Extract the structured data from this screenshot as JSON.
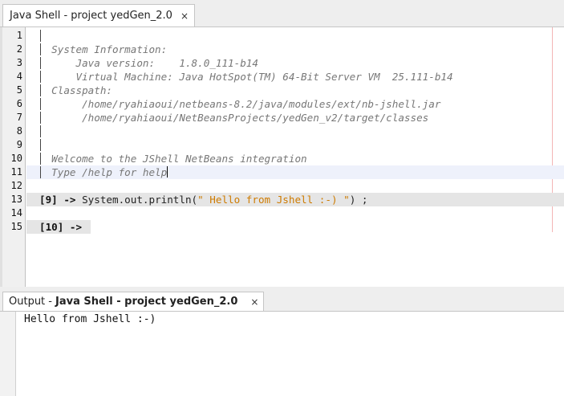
{
  "editor_tab": {
    "title": "Java Shell - project yedGen_2.0",
    "close": "×"
  },
  "editor": {
    "lines": [
      {
        "n": "1",
        "bar": true,
        "parts": []
      },
      {
        "n": "2",
        "bar": true,
        "parts": [
          {
            "t": "  System Information:",
            "c": "info"
          }
        ]
      },
      {
        "n": "3",
        "bar": true,
        "parts": [
          {
            "t": "      Java version:    1.8.0_111-b14",
            "c": "info"
          }
        ]
      },
      {
        "n": "4",
        "bar": true,
        "parts": [
          {
            "t": "      Virtual Machine: Java HotSpot(TM) 64-Bit Server VM  25.111-b14",
            "c": "info"
          }
        ]
      },
      {
        "n": "5",
        "bar": true,
        "parts": [
          {
            "t": "  Classpath:",
            "c": "info"
          }
        ]
      },
      {
        "n": "6",
        "bar": true,
        "parts": [
          {
            "t": "       /home/ryahiaoui/netbeans-8.2/java/modules/ext/nb-jshell.jar",
            "c": "info"
          }
        ]
      },
      {
        "n": "7",
        "bar": true,
        "parts": [
          {
            "t": "       /home/ryahiaoui/NetBeansProjects/yedGen_v2/target/classes",
            "c": "info"
          }
        ]
      },
      {
        "n": "8",
        "bar": true,
        "parts": []
      },
      {
        "n": "9",
        "bar": true,
        "parts": []
      },
      {
        "n": "10",
        "bar": true,
        "parts": [
          {
            "t": "  Welcome to the JShell NetBeans integration",
            "c": "info"
          }
        ]
      },
      {
        "n": "11",
        "bar": true,
        "current": true,
        "caret": true,
        "parts": [
          {
            "t": "  Type /help for help",
            "c": "info"
          }
        ]
      },
      {
        "n": "12",
        "bar": false,
        "parts": []
      },
      {
        "n": "13",
        "bar": false,
        "cmd": true,
        "parts": [
          {
            "t": "[9] -> ",
            "c": "prompt"
          },
          {
            "t": "System.out.println(",
            "c": ""
          },
          {
            "t": "\" Hello from Jshell :-) \"",
            "c": "str"
          },
          {
            "t": ") ;",
            "c": ""
          }
        ]
      },
      {
        "n": "14",
        "bar": false,
        "parts": []
      },
      {
        "n": "15",
        "bar": false,
        "cmd_short": true,
        "parts": [
          {
            "t": "[10] -> ",
            "c": "prompt"
          }
        ]
      }
    ]
  },
  "output_tab": {
    "prefix": "Output -",
    "title": "Java Shell - project yedGen_2.0",
    "close": "×"
  },
  "output": {
    "text": "Hello from Jshell :-)"
  }
}
